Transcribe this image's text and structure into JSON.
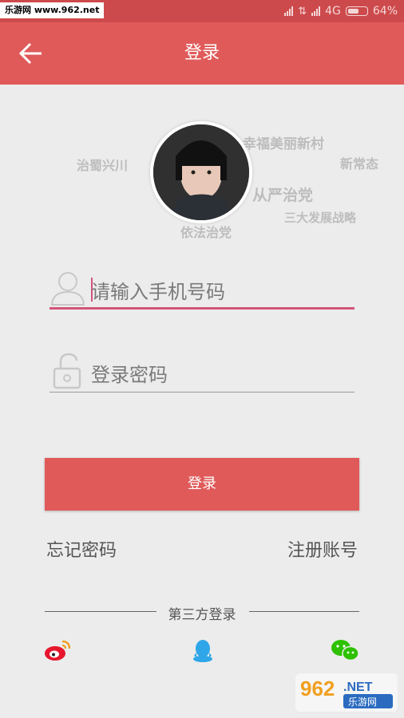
{
  "status_bar": {
    "watermark": "乐游网 www.962.net",
    "network": "4G",
    "battery": "64%",
    "battery_level": 0.64
  },
  "app_bar": {
    "title": "登录",
    "back_icon": "arrow-left-icon"
  },
  "background_words": [
    "治蜀兴川",
    "幸福美丽新村",
    "依法治党",
    "新常态",
    "三大发展战略",
    "从严治党"
  ],
  "form": {
    "phone_placeholder": "请输入手机号码",
    "password_placeholder": "登录密码",
    "phone_icon": "user-icon",
    "password_icon": "unlock-icon"
  },
  "login_button": "登录",
  "links": {
    "forgot": "忘记密码",
    "register": "注册账号"
  },
  "third_party": {
    "label": "第三方登录",
    "providers": [
      "weibo-icon",
      "qq-icon",
      "wechat-icon"
    ]
  },
  "watermark_bottom": {
    "number": "962",
    "suffix": ".NET",
    "name": "乐游网"
  },
  "colors": {
    "primary": "#e05a5a",
    "accent_underline": "#d2547a",
    "weibo": "#e6162d",
    "qq": "#2ea6e8",
    "wechat": "#2dc100"
  }
}
